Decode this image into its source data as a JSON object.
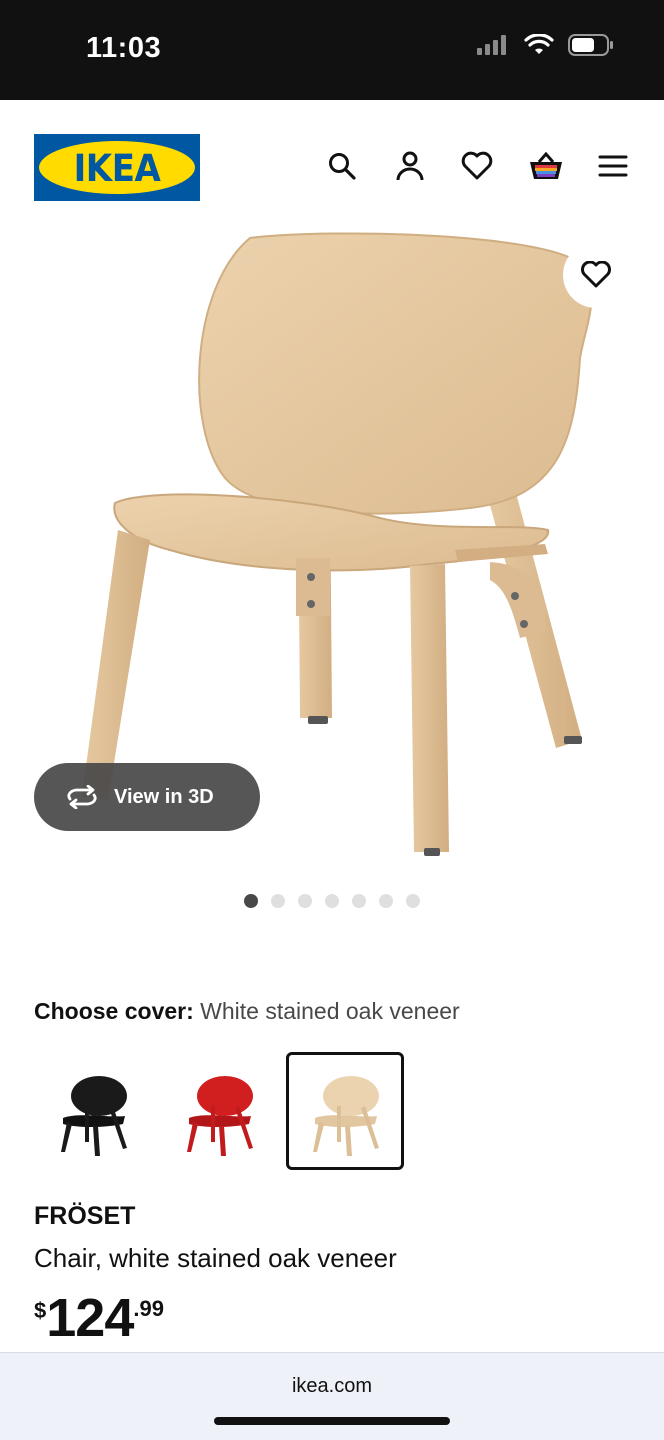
{
  "status_bar": {
    "time": "11:03"
  },
  "header": {
    "logo_text": "IKEA",
    "icons": [
      "search-icon",
      "account-icon",
      "favorites-icon",
      "cart-icon",
      "menu-icon"
    ],
    "brand_blue": "#0058a3",
    "brand_yellow": "#ffdb00"
  },
  "gallery": {
    "view_3d_label": "View in 3D",
    "image_count": 7,
    "active_index": 0
  },
  "cover": {
    "label": "Choose cover:",
    "value": "White stained oak veneer",
    "options": [
      {
        "name": "black",
        "color": "#1a1a1a"
      },
      {
        "name": "red",
        "color": "#c8191c"
      },
      {
        "name": "white stained oak",
        "color": "#e2c9a6",
        "selected": true
      }
    ]
  },
  "product": {
    "name": "FRÖSET",
    "description": "Chair, white stained oak veneer",
    "price": {
      "currency": "$",
      "integer": "124",
      "decimal": ".99"
    }
  },
  "browser": {
    "url": "ikea.com"
  }
}
